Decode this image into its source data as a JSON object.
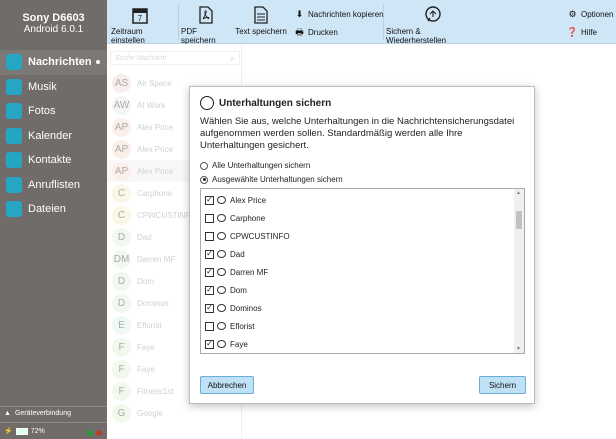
{
  "device": {
    "name": "Sony D6603",
    "os": "Android 6.0.1"
  },
  "sidebar": {
    "items": [
      {
        "label": "Nachrichten",
        "icon": "chat-icon",
        "active": true
      },
      {
        "label": "Musik",
        "icon": "music-icon"
      },
      {
        "label": "Fotos",
        "icon": "photo-icon"
      },
      {
        "label": "Kalender",
        "icon": "calendar-icon"
      },
      {
        "label": "Kontakte",
        "icon": "contacts-icon"
      },
      {
        "label": "Anruflisten",
        "icon": "phone-icon"
      },
      {
        "label": "Dateien",
        "icon": "files-icon"
      }
    ],
    "connection_label": "Geräteverbindung",
    "battery": "72%"
  },
  "toolbar": {
    "date_range": "Zeitraum einstellen",
    "pdf": "PDF speichern",
    "text": "Text speichern",
    "copy": "Nachrichten kopieren",
    "print": "Drucken",
    "backup": "Sichern & Wiederherstellen",
    "options": "Optionen",
    "help": "Hilfe"
  },
  "search": {
    "placeholder": "Suche Nachricht"
  },
  "contacts": [
    {
      "initials": "AS",
      "name": "Air Space",
      "color": "#f6dede"
    },
    {
      "initials": "AW",
      "name": "AI Work",
      "color": "#ececec"
    },
    {
      "initials": "AP",
      "name": "Alex Price",
      "color": "#f9e0d6"
    },
    {
      "initials": "AP",
      "name": "Alex Price",
      "color": "#f9e0d6"
    },
    {
      "initials": "AP",
      "name": "Alex Price",
      "color": "#f9e0d6",
      "selected": true
    },
    {
      "initials": "C",
      "name": "Carphone",
      "color": "#f7f0d2"
    },
    {
      "initials": "C",
      "name": "CPWCUSTINFO",
      "color": "#f7f0d2"
    },
    {
      "initials": "D",
      "name": "Dad",
      "color": "#e4f3e2"
    },
    {
      "initials": "DM",
      "name": "Darren  MF",
      "color": "#e4f3e2"
    },
    {
      "initials": "D",
      "name": "Dom",
      "color": "#e4f3e2"
    },
    {
      "initials": "D",
      "name": "Dominos",
      "color": "#e4f3e2"
    },
    {
      "initials": "E",
      "name": "Eflorist",
      "color": "#e2f3e8"
    },
    {
      "initials": "F",
      "name": "Faye",
      "color": "#e6f4dc"
    },
    {
      "initials": "F",
      "name": "Faye",
      "color": "#e6f4dc"
    },
    {
      "initials": "F",
      "name": "Fitness1st",
      "color": "#e6f4dc"
    },
    {
      "initials": "G",
      "name": "Google",
      "color": "#e6f4dc"
    }
  ],
  "dialog": {
    "title": "Unterhaltungen sichern",
    "description": "Wählen Sie aus, welche Unterhaltungen in die Nachrichtensicherungsdatei aufgenommen werden sollen. Standardmäßig werden alle Ihre Unterhaltungen gesichert.",
    "option_all": "Alle Unterhaltungen sichern",
    "option_selected": "Ausgewählte Unterhaltungen sichern",
    "selected_option": "selected",
    "list": [
      {
        "name": "Alex Price",
        "checked": true
      },
      {
        "name": "Carphone",
        "checked": false
      },
      {
        "name": "CPWCUSTINFO",
        "checked": false
      },
      {
        "name": "Dad",
        "checked": true
      },
      {
        "name": "Darren  MF",
        "checked": true
      },
      {
        "name": "Dom",
        "checked": true
      },
      {
        "name": "Dominos",
        "checked": true
      },
      {
        "name": "Eflorist",
        "checked": false
      },
      {
        "name": "Faye",
        "checked": true
      }
    ],
    "cancel": "Abbrechen",
    "save": "Sichern"
  },
  "colors": {
    "accent": "#27a6c3",
    "toolbar": "#cfe6f6",
    "sidebar": "#6f6c6a"
  }
}
